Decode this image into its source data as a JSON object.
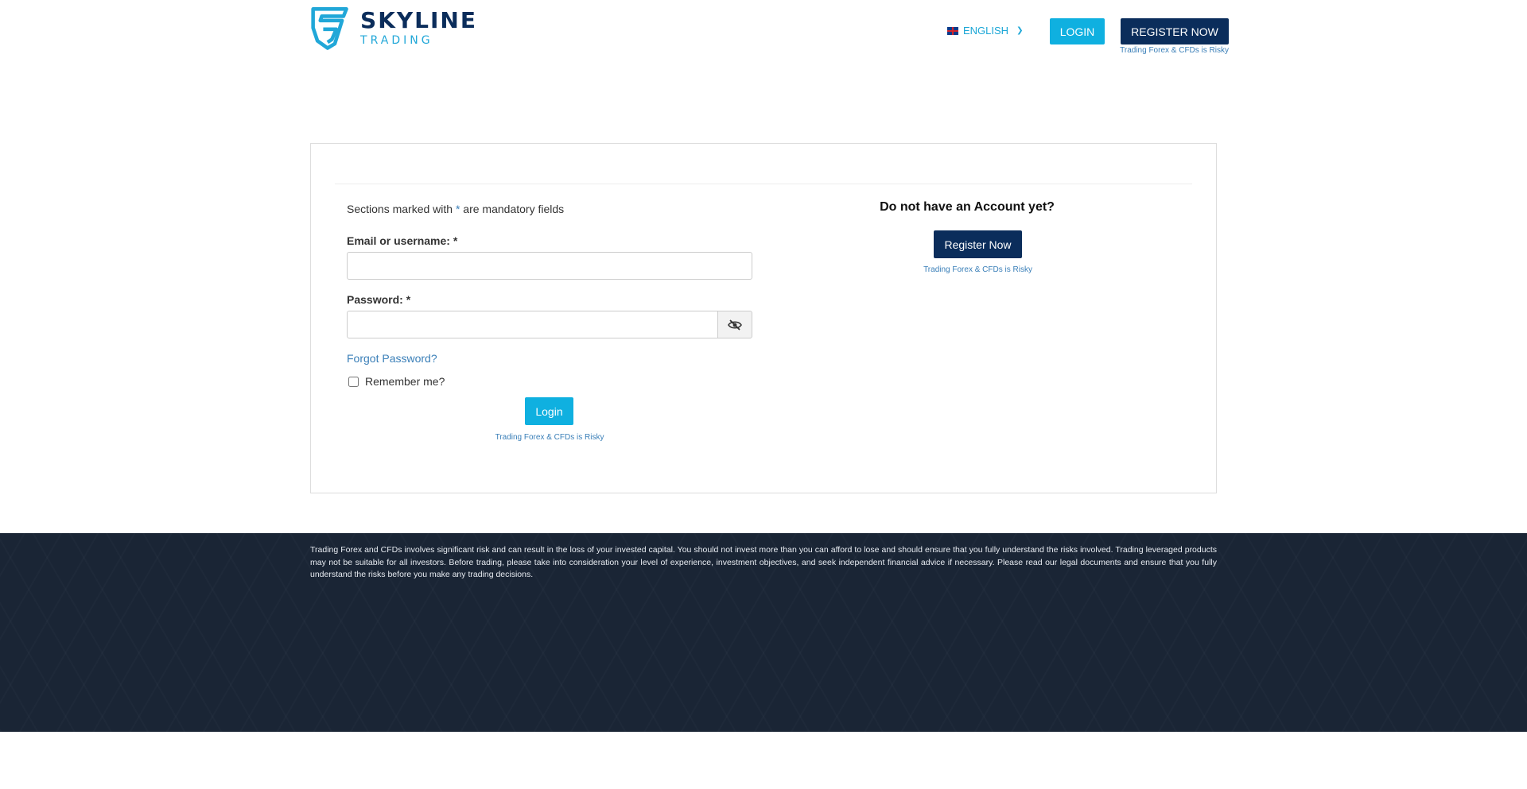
{
  "header": {
    "logo": {
      "main": "SKYLINE",
      "sub": "TRADING",
      "icon": "skyline-shield-logo"
    },
    "language": {
      "label": "ENGLISH",
      "flag": "uk-flag-icon"
    },
    "login_label": "LOGIN",
    "register_label": "REGISTER NOW",
    "risk_note": "Trading Forex & CFDs is Risky"
  },
  "login_form": {
    "mandatory_prefix": "Sections marked with ",
    "mandatory_star": "*",
    "mandatory_suffix": " are mandatory fields",
    "email_label": "Email or username: *",
    "email_value": "",
    "password_label": "Password: *",
    "password_value": "",
    "toggle_icon": "eye-slash-icon",
    "forgot_label": "Forgot Password?",
    "remember_label": "Remember me?",
    "remember_checked": false,
    "login_label": "Login",
    "risk_note": "Trading Forex & CFDs is Risky"
  },
  "register_panel": {
    "heading": "Do not have an Account yet?",
    "register_label": "Register Now",
    "risk_note": "Trading Forex & CFDs is Risky"
  },
  "footer": {
    "disclaimer": "Trading Forex and CFDs involves significant risk and can result in the loss of your invested capital. You should not invest more than you can afford to lose and should ensure that you fully understand the risks involved. Trading leveraged products may not be suitable for all investors. Before trading, please take into consideration your level of experience, investment objectives, and seek independent financial advice if necessary. Please read our legal documents and ensure that you fully understand the risks before you make any trading decisions."
  },
  "colors": {
    "brand_dark": "#0b2d5b",
    "brand_light": "#0fb0e0",
    "link": "#3a7fb8",
    "footer_bg": "#1a2535"
  }
}
